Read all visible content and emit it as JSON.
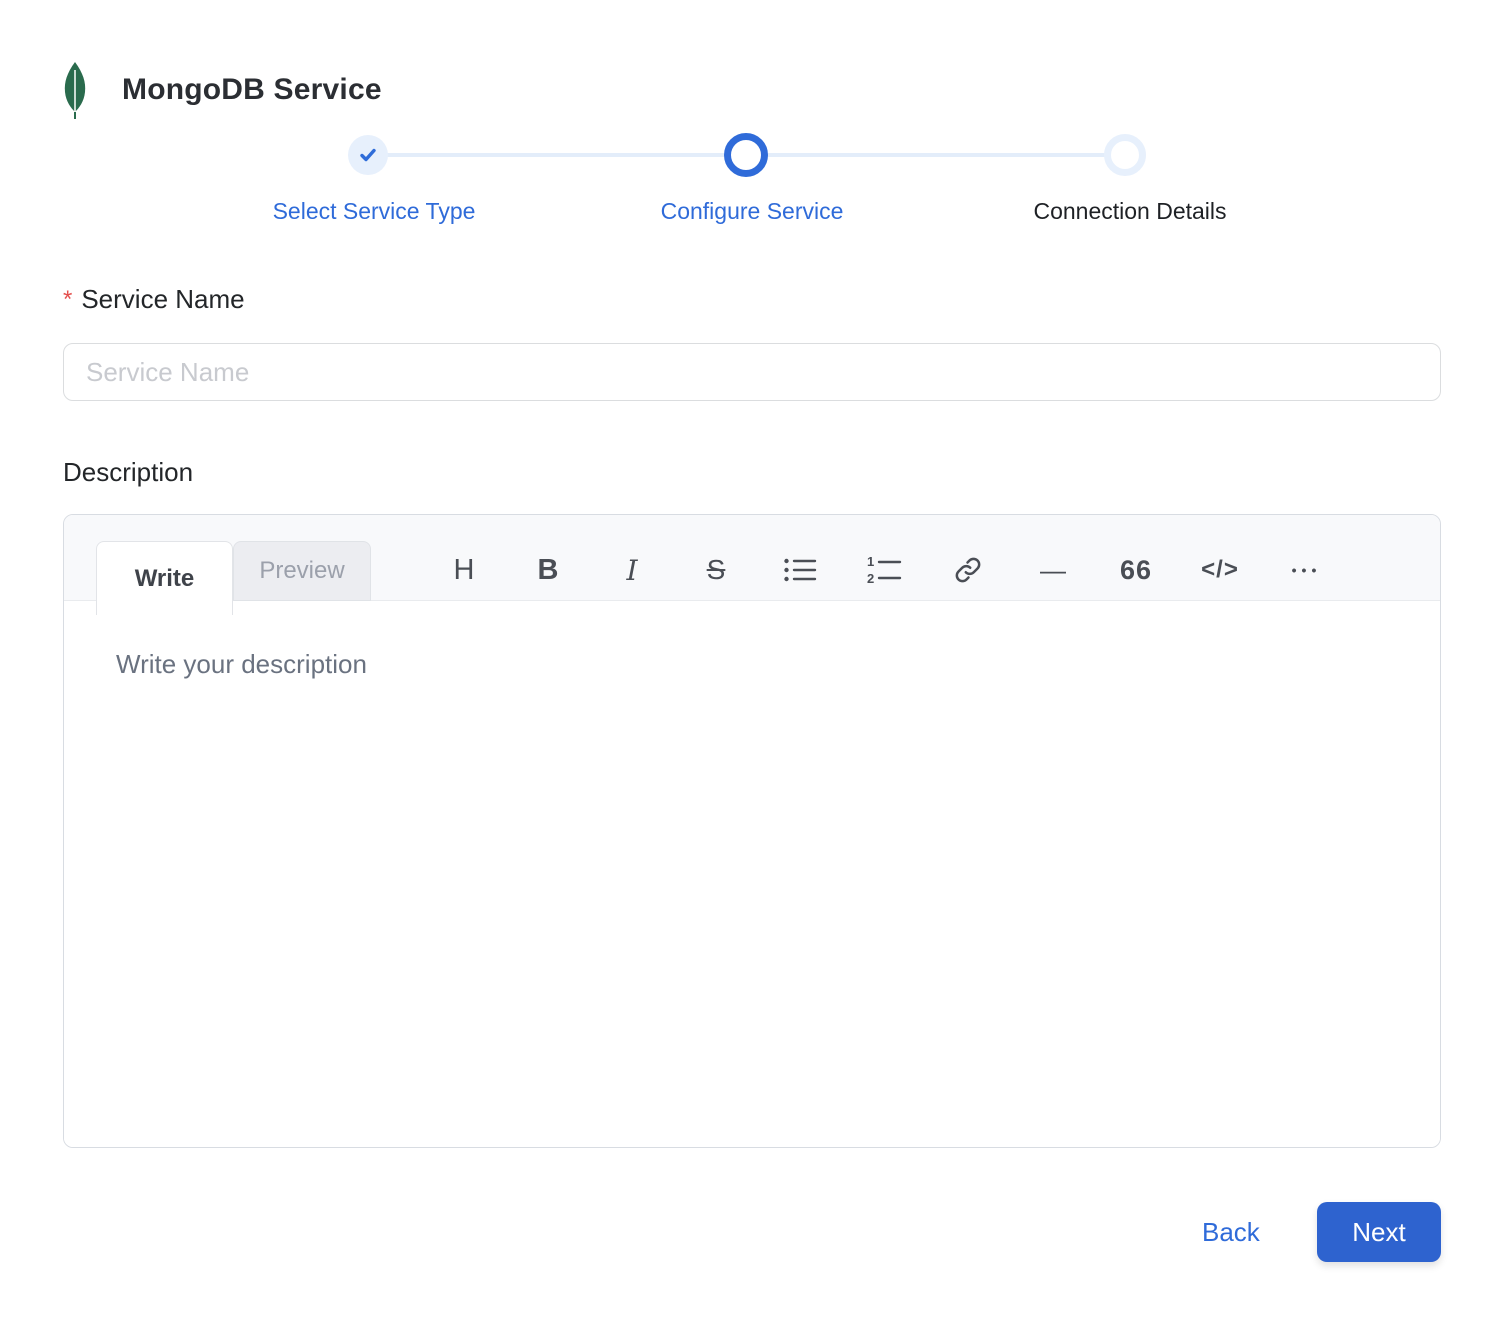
{
  "header": {
    "title": "MongoDB Service"
  },
  "stepper": {
    "steps": [
      {
        "label": "Select Service Type",
        "state": "completed"
      },
      {
        "label": "Configure Service",
        "state": "active"
      },
      {
        "label": "Connection Details",
        "state": "pending"
      }
    ]
  },
  "form": {
    "service_name": {
      "label": "Service Name",
      "required_marker": "*",
      "placeholder": "Service Name",
      "value": ""
    },
    "description": {
      "label": "Description"
    }
  },
  "editor": {
    "tabs": [
      {
        "label": "Write",
        "active": true
      },
      {
        "label": "Preview",
        "active": false
      }
    ],
    "placeholder": "Write your description",
    "toolbar": {
      "heading": "H",
      "bold": "B",
      "italic": "I",
      "strikethrough": "S",
      "horizontal_rule": "—",
      "quote": "66",
      "code": "</>",
      "more": "•••"
    }
  },
  "footer": {
    "back_label": "Back",
    "next_label": "Next"
  },
  "colors": {
    "accent_blue": "#2f6bd9",
    "button_blue": "#2e63cf",
    "light_blue": "#e7f0fc",
    "mongo_green": "#2a6b4d",
    "required_red": "#e4504e"
  }
}
